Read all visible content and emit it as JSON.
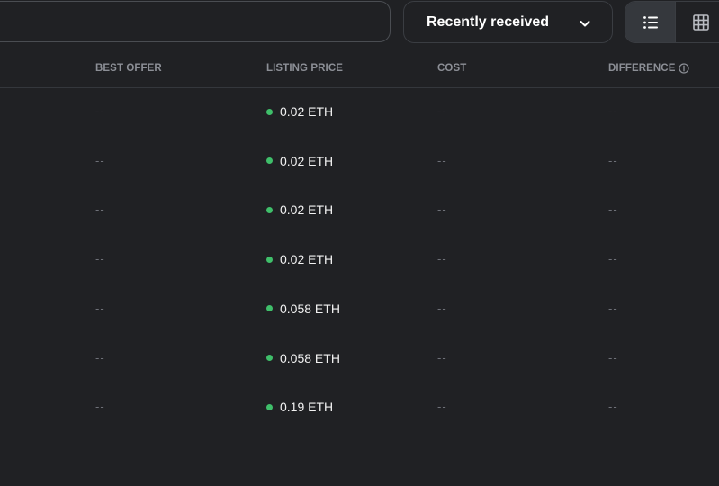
{
  "toolbar": {
    "sort_label": "Recently received",
    "chevron_icon": "chevron-down-icon",
    "list_view_icon": "list-icon",
    "grid_view_icon": "grid-icon"
  },
  "table": {
    "headers": {
      "best_offer": "BEST OFFER",
      "listing_price": "LISTING PRICE",
      "cost": "COST",
      "difference": "DIFFERENCE"
    },
    "listed_color": "#3fbf6a",
    "rows": [
      {
        "best_offer": "--",
        "listing_price": "0.02 ETH",
        "cost": "--",
        "difference": "--"
      },
      {
        "best_offer": "--",
        "listing_price": "0.02 ETH",
        "cost": "--",
        "difference": "--"
      },
      {
        "best_offer": "--",
        "listing_price": "0.02 ETH",
        "cost": "--",
        "difference": "--"
      },
      {
        "best_offer": "--",
        "listing_price": "0.02 ETH",
        "cost": "--",
        "difference": "--"
      },
      {
        "best_offer": "--",
        "listing_price": "0.058 ETH",
        "cost": "--",
        "difference": "--"
      },
      {
        "best_offer": "--",
        "listing_price": "0.058 ETH",
        "cost": "--",
        "difference": "--"
      },
      {
        "best_offer": "--",
        "listing_price": "0.19 ETH",
        "cost": "--",
        "difference": "--"
      }
    ]
  }
}
